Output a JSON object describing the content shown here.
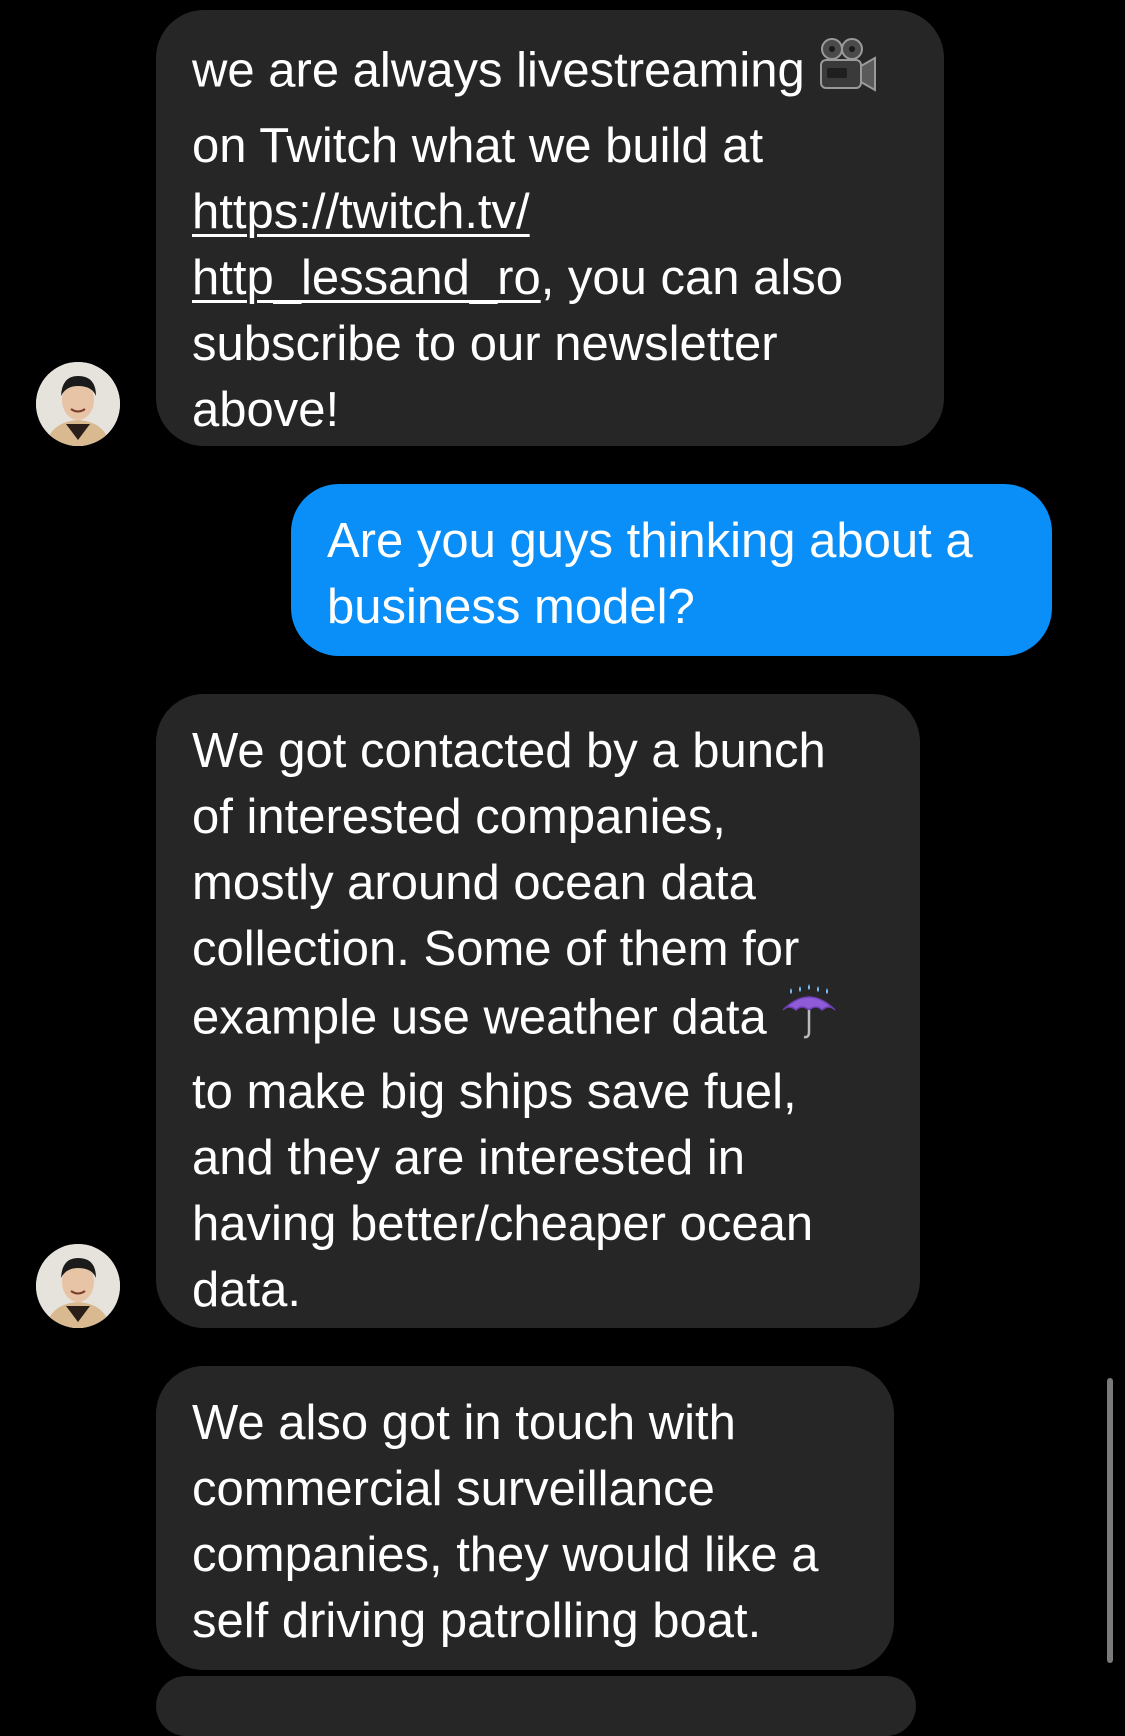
{
  "messages": [
    {
      "sender": "incoming",
      "lines": [
        "we are always livestreaming",
        "on Twitch what we build at",
        "https://twitch.tv/",
        "http_lessand_ro",
        ", you can also",
        "subscribe to our newsletter",
        "above!"
      ],
      "emoji": "movie-camera"
    },
    {
      "sender": "outgoing",
      "lines": [
        "Are you guys thinking about a",
        "business model?"
      ]
    },
    {
      "sender": "incoming",
      "lines": [
        "We got contacted by a bunch",
        "of interested companies,",
        "mostly around ocean data",
        "collection. Some of them for",
        "example use weather data",
        "to make big ships save fuel,",
        "and they are interested in",
        "having better/cheaper ocean",
        "data."
      ],
      "emoji": "umbrella-with-rain"
    },
    {
      "sender": "incoming",
      "lines": [
        "We also got in touch with",
        "commercial surveillance",
        "companies, they would like a",
        "self driving patrolling boat."
      ]
    }
  ],
  "colors": {
    "background": "#000000",
    "incoming_bubble": "#262626",
    "outgoing_bubble": "#0a8ef7",
    "text": "#ffffff"
  }
}
